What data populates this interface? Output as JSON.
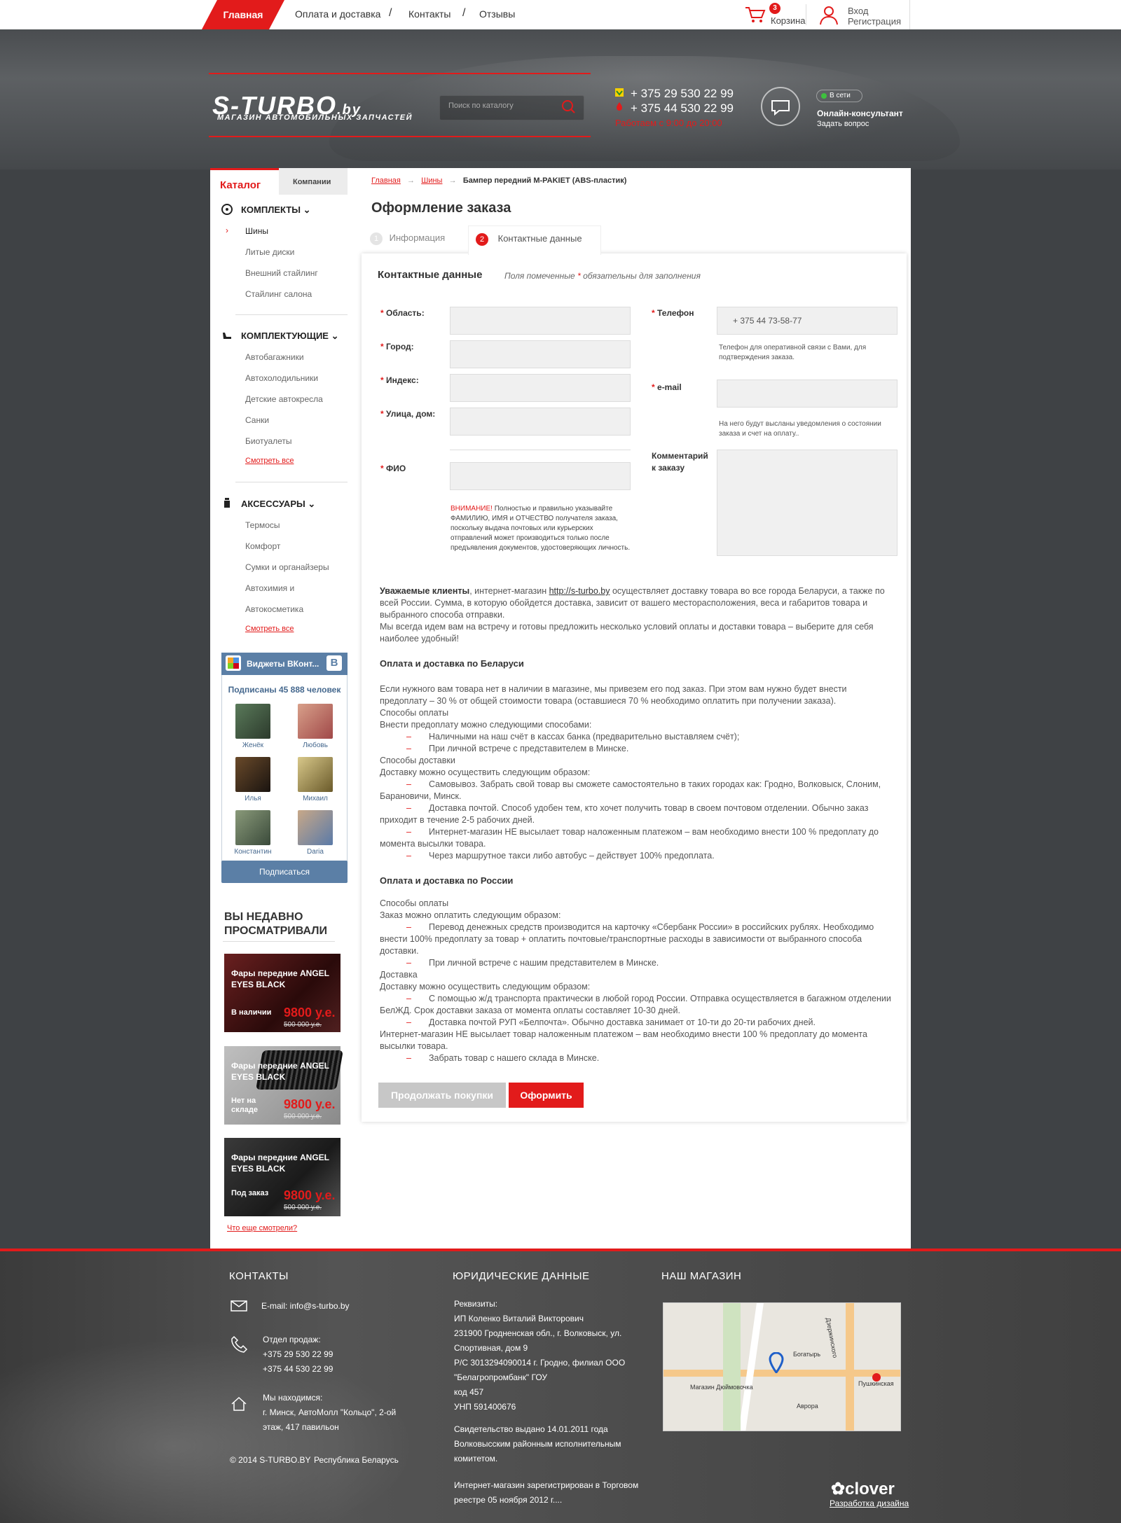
{
  "topnav": {
    "home": "Главная",
    "items": [
      "Оплата и доставка",
      "Контакты",
      "Отзывы"
    ],
    "separator": "/",
    "cart_count": "3",
    "cart_label": "Корзина",
    "login": "Вход",
    "register": "Регистрация"
  },
  "header": {
    "logo": "S-TURBO",
    "logo_tld": ".by",
    "tagline": "МАГАЗИН АВТОМОБИЛЬНЫХ ЗАПЧАСТЕЙ",
    "search_placeholder": "Поиск по каталогу",
    "phone1": "+ 375 29 530 22 99",
    "phone2": "+ 375 44 530 22 99",
    "hours": "Работаем с 9:00 до 20:00",
    "online_status": "В сети",
    "consultant": "Онлайн-консультант",
    "ask": "Задать вопрос"
  },
  "sidebar": {
    "tab_catalog": "Каталог",
    "tab_companies": "Компании",
    "groups": [
      {
        "title": "КОМПЛЕКТЫ",
        "items": [
          "Шины",
          "Литые диски",
          "Внешний стайлинг",
          "Стайлинг салона"
        ]
      },
      {
        "title": "КОМПЛЕКТУЮЩИЕ",
        "items": [
          "Автобагажники",
          "Автохолодильники",
          "Детские автокресла",
          "Санки",
          "Биотуалеты"
        ],
        "see_all": "Смотреть все"
      },
      {
        "title": "АКСЕССУАРЫ",
        "items": [
          "Термосы",
          "Комфорт",
          "Сумки и органайзеры",
          "Автохимия и",
          "Автокосметика"
        ],
        "see_all": "Смотреть все"
      }
    ],
    "vk": {
      "title": "Виджеты ВКонт...",
      "subscribers": "Подписаны 45 888 человек",
      "people": [
        "Женёк",
        "Любовь",
        "Илья",
        "Михаил",
        "Константин",
        "Daria"
      ],
      "subscribe": "Подписаться"
    },
    "recent": {
      "title_line1": "ВЫ НЕДАВНО",
      "title_line2": "ПРОСМАТРИВАЛИ",
      "cards": [
        {
          "title": "Фары передние ANGEL EYES BLACK",
          "status": "В наличии",
          "price": "9800 у.е.",
          "old_price": "500 000 у.е."
        },
        {
          "title": "Фары передние ANGEL EYES BLACK",
          "status": "Нет на складе",
          "price": "9800 у.е.",
          "old_price": "500 000 у.е."
        },
        {
          "title": "Фары передние ANGEL EYES BLACK",
          "status": "Под заказ",
          "price": "9800 у.е.",
          "old_price": "500 000 у.е."
        }
      ],
      "more": "Что еще смотрели?"
    }
  },
  "content": {
    "breadcrumb": [
      "Главная",
      "Шины",
      "Бампер передний M-PAKIET (ABS-пластик)"
    ],
    "title": "Оформление заказа",
    "steps": [
      {
        "num": "1",
        "label": "Информация"
      },
      {
        "num": "2",
        "label": "Контактные данные"
      }
    ],
    "form": {
      "title": "Контактные данные",
      "required_note_pre": "Поля помеченные ",
      "required_star": "*",
      "required_note_post": " обязательны для заполнения",
      "fields_left": [
        "Область:",
        "Город:",
        "Индекс:",
        "Улица, дом:",
        "ФИО"
      ],
      "phone_label": "Телефон",
      "phone_value": "+ 375 44 73-58-77",
      "phone_hint": "Телефон для оперативной связи с Вами, для подтверждения заказа.",
      "email_label": "e-mail",
      "email_hint": "На него будут высланы уведомления о состоянии заказа и счет на оплату..",
      "comment_label": "Комментарий к заказу",
      "warning_red": "ВНИМАНИЕ!",
      "warning_text": " Полностью и правильно указывайте ФАМИЛИЮ, ИМЯ и ОТЧЕСТВО получателя заказа, поскольку выдача почтовых или курьерских отправлений может производиться только после предъявления документов, удостоверяющих личность."
    },
    "info": {
      "intro_bold": "Уважаемые клиенты",
      "intro_1": ", интернет-магазин ",
      "intro_link": "http://s-turbo.by",
      "intro_2": "  осуществляет доставку товара во все города Беларуси, а также по всей России.  Сумма, в которую обойдется доставка, зависит от вашего месторасположения, веса и габаритов товара и выбранного способа отправки.",
      "intro_3": "Мы всегда идем вам на встречу и готовы предложить несколько условий оплаты и доставки товара – выберите для себя наиболее удобный!",
      "by_title": "Оплата и доставка по Беларуси",
      "by_lines": [
        "Если нужного вам товара нет в наличии в магазине, мы привезем его под заказ. При этом  вам нужно будет внести предоплату – 30 % от общей стоимости товара (оставшиеся 70 %  необходимо оплатить при получении заказа).",
        "Способы оплаты",
        "Внести предоплату можно следующими способами:"
      ],
      "by_pay": [
        "Наличными на наш счёт в кассах банка (предварительно выставляем счёт);",
        "При личной встрече с представителем в  Минске."
      ],
      "by_delivery_title": "Способы доставки",
      "by_delivery_intro": "Доставку можно осуществить следующим образом:",
      "by_delivery": [
        "Самовывоз.  Забрать свой товар вы сможете самостоятельно в таких городах как: Гродно, Волковыск, Слоним, Барановичи, Минск.",
        "Доставка почтой.  Способ удобен тем, кто хочет получить товар в своем почтовом отделении. Обычно заказ приходит в течение 2-5 рабочих дней.",
        "Интернет-магазин НЕ высылает товар наложенным платежом – вам необходимо внести 100 % предоплату до момента высылки товара.",
        "Через маршрутное такси либо автобус – действует 100% предоплата."
      ],
      "ru_title": "Оплата и доставка по России",
      "ru_pay_title": "Способы оплаты",
      "ru_pay_intro": "Заказ можно оплатить следующим образом:",
      "ru_pay": [
        "Перевод денежных средств производится на карточку «Сбербанк России» в российских рублях.  Необходимо внести 100% предоплату за товар +  оплатить почтовые/транспортные расходы в зависимости от выбранного способа доставки.",
        "При личной встрече с нашим представителем в Минске."
      ],
      "ru_delivery_title": "Доставка",
      "ru_delivery_intro": "Доставку можно осуществить следующим образом:",
      "ru_delivery": [
        "С помощью ж/д транспорта практически в любой город России.  Отправка осуществляется в багажном отделении БелЖД. Срок доставки заказа от момента оплаты составляет 10-30 дней.",
        "Доставка почтой РУП «Белпочта». Обычно доставка занимает от 10-ти до 20-ти рабочих дней."
      ],
      "ru_note": "Интернет-магазин НЕ высылает товар наложенным платежом – вам необходимо внести 100 % предоплату до момента высылки товара.",
      "ru_last": "Забрать товар с нашего склада в Минске."
    },
    "btn_continue": "Продолжать покупки",
    "btn_submit": "Оформить"
  },
  "footer": {
    "contacts_title": "КОНТАКТЫ",
    "email": "E-mail: info@s-turbo.by",
    "sales_title": "Отдел продаж:",
    "sales_phone1": "+375 29 530 22 99",
    "sales_phone2": "+375 44 530 22 99",
    "location_title": "Мы находимся:",
    "location": "г. Минск, АвтоМолл \"Кольцо\", 2-ой этаж, 417 павильон",
    "copyright": "© 2014 S-TURBO.BY",
    "country": "Республика Беларусь",
    "legal_title": "ЮРИДИЧЕСКИЕ ДАННЫЕ",
    "legal_lines": [
      "Реквизиты:",
      "ИП Коленко Виталий Викторович",
      "231900 Гродненская обл., г. Волковыск, ул.",
      "Спортивная, дом 9",
      "Р/С 3013294090014 г. Гродно, филиал ООО",
      "\"Белагропромбанк\" ГОУ",
      "код 457",
      "УНП 591400676"
    ],
    "cert_lines": [
      "Свидетельство выдано 14.01.2011 года",
      "Волковысским районным исполнительным",
      "комитетом."
    ],
    "reg_lines": [
      "Интернет-магазин зарегистрирован в Торговом",
      "реестре 05 ноября 2012 г...."
    ],
    "shop_title": "НАШ МАГАЗИН",
    "map_labels": [
      "Дзержинского",
      "Пушкинская",
      "Богатырь",
      "Аврора",
      "Магазин Дюймовочка"
    ],
    "clover": "clover",
    "design": "Разработка дизайна"
  }
}
